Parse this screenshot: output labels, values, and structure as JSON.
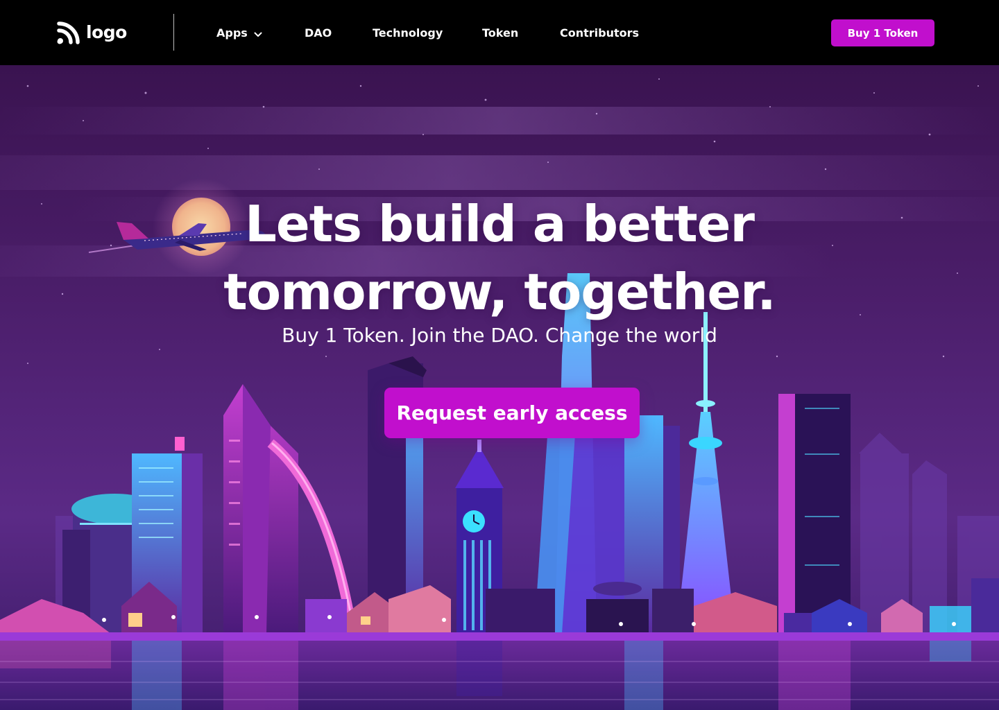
{
  "brand": {
    "logo_text": "logo",
    "accent_color": "#c10fcd"
  },
  "nav": {
    "items": [
      {
        "label": "Apps",
        "has_dropdown": true,
        "icon": "chevron-down-icon"
      },
      {
        "label": "DAO"
      },
      {
        "label": "Technology"
      },
      {
        "label": "Token"
      },
      {
        "label": "Contributors"
      }
    ],
    "cta_label": "Buy 1 Token"
  },
  "hero": {
    "headline_line1": "Lets build a better",
    "headline_line2": "tomorrow, together.",
    "subheadline": "Buy 1 Token. Join the DAO. Change the world",
    "cta_label": "Request early access",
    "illustration": "neon night city skyline with airplane, moon, TV tower and reflections"
  }
}
